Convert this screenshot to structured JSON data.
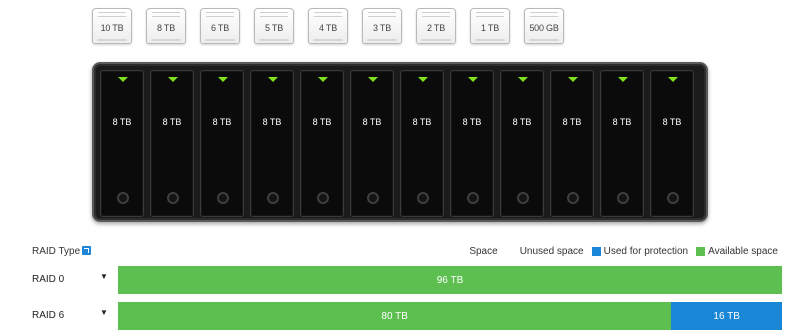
{
  "drive_options": [
    "10 TB",
    "8 TB",
    "6 TB",
    "5 TB",
    "4 TB",
    "3 TB",
    "2 TB",
    "1 TB",
    "500 GB"
  ],
  "bays": [
    "8 TB",
    "8 TB",
    "8 TB",
    "8 TB",
    "8 TB",
    "8 TB",
    "8 TB",
    "8 TB",
    "8 TB",
    "8 TB",
    "8 TB",
    "8 TB"
  ],
  "raid_type_label": "RAID Type",
  "legend": {
    "title": "Space",
    "unused": "Unused space",
    "protection": "Used for protection",
    "available": "Available space"
  },
  "colors": {
    "available": "#5cbf4f",
    "protection": "#1a86d6",
    "unused": "#e3e3e3",
    "led": "#7fe01b"
  },
  "raid_rows": [
    {
      "name": "RAID 0",
      "dropdown": "▼",
      "available": "96 TB",
      "available_tb": 96,
      "protection": "",
      "protection_tb": 0
    },
    {
      "name": "RAID 6",
      "dropdown": "▼",
      "available": "80 TB",
      "available_tb": 80,
      "protection": "16 TB",
      "protection_tb": 16
    }
  ]
}
